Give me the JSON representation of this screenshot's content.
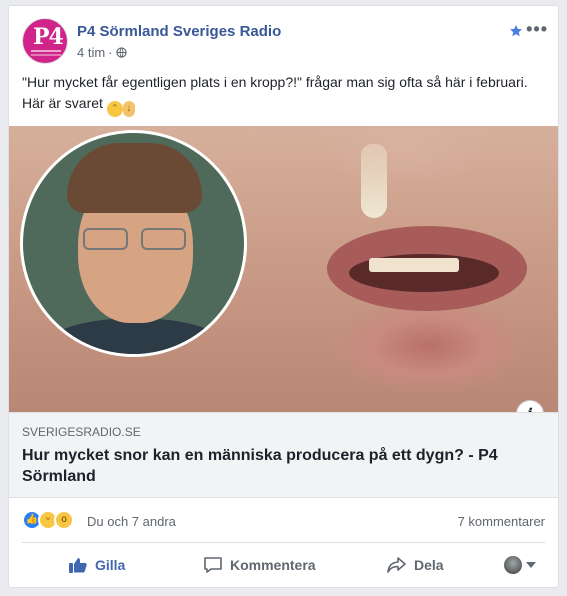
{
  "post": {
    "page_name": "P4 Sörmland Sveriges Radio",
    "time": "4 tim",
    "separator": "·",
    "avatar_text": "P4",
    "text": "\"Hur mycket får egentligen plats i en kropp?!\" frågar man sig ofta så här i februari. Här är svaret",
    "text_emojis": [
      "crying-face-emoji",
      "pointing-down-emoji"
    ]
  },
  "link": {
    "domain": "SVERIGESRADIO.SE",
    "title": "Hur mycket snor kan en människa producera på ett dygn? - P4 Sörmland",
    "info_glyph": "i"
  },
  "stats": {
    "reactions": [
      "like",
      "haha",
      "wow"
    ],
    "who_reacted": "Du och 7 andra",
    "comments": "7 kommentarer"
  },
  "actions": {
    "like": "Gilla",
    "comment": "Kommentera",
    "share": "Dela"
  },
  "colors": {
    "brand_link": "#385898",
    "like_blue": "#4267b2",
    "avatar_pink": "#d0248a"
  }
}
